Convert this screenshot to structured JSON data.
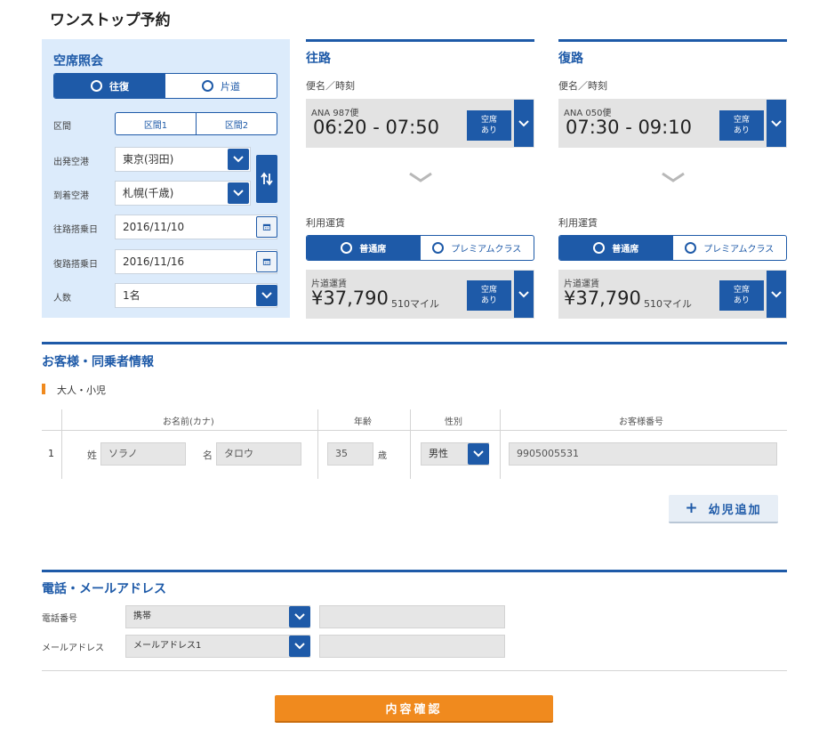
{
  "page_title": "ワンストップ予約",
  "search": {
    "title": "空席照会",
    "trip_type": {
      "round": "往復",
      "oneway": "片道"
    },
    "segment_label": "区間",
    "segments": [
      "区間1",
      "区間2"
    ],
    "from_label": "出発空港",
    "from_value": "東京(羽田)",
    "to_label": "到着空港",
    "to_value": "札幌(千歳)",
    "outbound_date_label": "往路搭乗日",
    "outbound_date_value": "2016/11/10",
    "return_date_label": "復路搭乗日",
    "return_date_value": "2016/11/16",
    "pax_label": "人数",
    "pax_value": "1名"
  },
  "outbound": {
    "title": "往路",
    "flight_label": "便名／時刻",
    "flight_no": "ANA 987便",
    "time": "06:20 - 07:50",
    "avail_line1": "空席",
    "avail_line2": "あり",
    "fare_label": "利用運賃",
    "fare_normal": "普通席",
    "fare_premium": "プレミアムクラス",
    "fare_type": "片道運賃",
    "price": "¥37,790",
    "miles": "510マイル",
    "fare_avail_line1": "空席",
    "fare_avail_line2": "あり"
  },
  "return": {
    "title": "復路",
    "flight_label": "便名／時刻",
    "flight_no": "ANA 050便",
    "time": "07:30 - 09:10",
    "avail_line1": "空席",
    "avail_line2": "あり",
    "fare_label": "利用運賃",
    "fare_normal": "普通席",
    "fare_premium": "プレミアムクラス",
    "fare_type": "片道運賃",
    "price": "¥37,790",
    "miles": "510マイル",
    "fare_avail_line1": "空席",
    "fare_avail_line2": "あり"
  },
  "passengers": {
    "title": "お客様・同乗者情報",
    "subhead": "大人・小児",
    "headers": {
      "name": "お名前(カナ)",
      "age": "年齢",
      "gender": "性別",
      "member": "お客様番号"
    },
    "rows": [
      {
        "no": "1",
        "last_label": "姓",
        "last": "ソラノ",
        "first_label": "名",
        "first": "タロウ",
        "age": "35",
        "age_unit": "歳",
        "gender": "男性",
        "member": "9905005531"
      }
    ],
    "add_infant": "幼児追加"
  },
  "contact": {
    "title": "電話・メールアドレス",
    "phone_label": "電話番号",
    "phone_type": "携帯",
    "phone_value": "",
    "email_label": "メールアドレス",
    "email_type": "メールアドレス1",
    "email_value": ""
  },
  "confirm_label": "内容確認",
  "colors": {
    "brand": "#1e5aa8",
    "panel": "#dcebfb",
    "confirm": "#f08a1e",
    "accent_bar": "#f08a1e"
  }
}
